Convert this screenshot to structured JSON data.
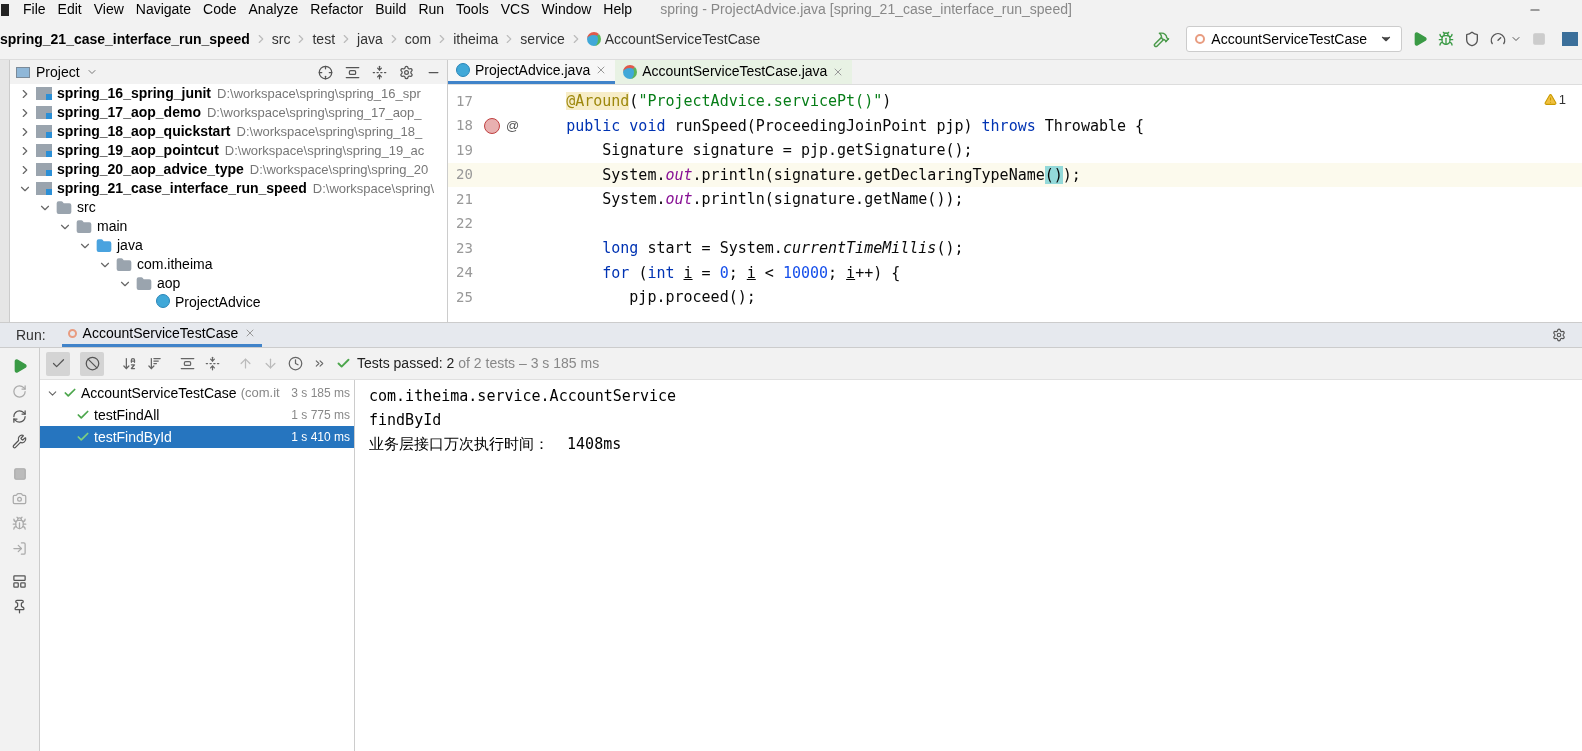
{
  "menu": [
    "File",
    "Edit",
    "View",
    "Navigate",
    "Code",
    "Analyze",
    "Refactor",
    "Build",
    "Run",
    "Tools",
    "VCS",
    "Window",
    "Help"
  ],
  "window_title": "spring - ProjectAdvice.java [spring_21_case_interface_run_speed]",
  "breadcrumbs": [
    {
      "label": "spring_21_case_interface_run_speed",
      "kind": "project"
    },
    {
      "label": "src",
      "kind": "folder"
    },
    {
      "label": "test",
      "kind": "folder"
    },
    {
      "label": "java",
      "kind": "folder"
    },
    {
      "label": "com",
      "kind": "folder"
    },
    {
      "label": "itheima",
      "kind": "folder"
    },
    {
      "label": "service",
      "kind": "folder"
    },
    {
      "label": "AccountServiceTestCase",
      "kind": "class"
    }
  ],
  "run_config": "AccountServiceTestCase",
  "project_panel": {
    "title": "Project",
    "tree": [
      {
        "name": "spring_16_spring_junit",
        "path": "D:\\workspace\\spring\\spring_16_spr",
        "kind": "module",
        "expanded": false
      },
      {
        "name": "spring_17_aop_demo",
        "path": "D:\\workspace\\spring\\spring_17_aop_",
        "kind": "module",
        "expanded": false
      },
      {
        "name": "spring_18_aop_quickstart",
        "path": "D:\\workspace\\spring\\spring_18_",
        "kind": "module",
        "expanded": false
      },
      {
        "name": "spring_19_aop_pointcut",
        "path": "D:\\workspace\\spring\\spring_19_ac",
        "kind": "module",
        "expanded": false
      },
      {
        "name": "spring_20_aop_advice_type",
        "path": "D:\\workspace\\spring\\spring_20",
        "kind": "module",
        "expanded": false
      },
      {
        "name": "spring_21_case_interface_run_speed",
        "path": "D:\\workspace\\spring\\",
        "kind": "module",
        "expanded": true,
        "children": [
          {
            "name": "src",
            "kind": "folder",
            "expanded": true,
            "children": [
              {
                "name": "main",
                "kind": "folder",
                "expanded": true,
                "children": [
                  {
                    "name": "java",
                    "kind": "source",
                    "expanded": true,
                    "children": [
                      {
                        "name": "com.itheima",
                        "kind": "package",
                        "expanded": true,
                        "children": [
                          {
                            "name": "aop",
                            "kind": "package",
                            "expanded": true,
                            "children": [
                              {
                                "name": "ProjectAdvice",
                                "kind": "class"
                              }
                            ]
                          }
                        ]
                      }
                    ]
                  }
                ]
              }
            ]
          }
        ]
      }
    ]
  },
  "editor_tabs": [
    {
      "label": "ProjectAdvice.java",
      "selected": true,
      "kind": "class"
    },
    {
      "label": "AccountServiceTestCase.java",
      "selected": false,
      "kind": "test"
    }
  ],
  "warning_count": "1",
  "code_lines": [
    {
      "number": "17",
      "current": false,
      "tokens": [
        {
          "kind": "annotation",
          "text": "    @Around"
        },
        {
          "kind": "plain",
          "text": "("
        },
        {
          "kind": "string",
          "text": "\"ProjectAdvice.servicePt()\""
        },
        {
          "kind": "plain",
          "text": ")"
        }
      ]
    },
    {
      "number": "18",
      "current": false,
      "gutter_mark": "@",
      "tokens": [
        {
          "kind": "keyword",
          "text": "    public void "
        },
        {
          "kind": "plain",
          "text": "runSpeed(ProceedingJoinPoint pjp) "
        },
        {
          "kind": "keyword",
          "text": "throws "
        },
        {
          "kind": "plain",
          "text": "Throwable {"
        }
      ]
    },
    {
      "number": "19",
      "current": false,
      "tokens": [
        {
          "kind": "plain",
          "text": "        Signature signature = pjp.getSignature();"
        }
      ]
    },
    {
      "number": "20",
      "current": true,
      "tokens": [
        {
          "kind": "plain",
          "text": "        System."
        },
        {
          "kind": "field",
          "text": "out"
        },
        {
          "kind": "plain",
          "text": ".println(signature.getDeclaringTypeName"
        },
        {
          "kind": "bracket",
          "text": "()"
        },
        {
          "kind": "plain",
          "text": ");"
        }
      ]
    },
    {
      "number": "21",
      "current": false,
      "tokens": [
        {
          "kind": "plain",
          "text": "        System."
        },
        {
          "kind": "field",
          "text": "out"
        },
        {
          "kind": "plain",
          "text": ".println(signature.getName());"
        }
      ]
    },
    {
      "number": "22",
      "current": false
    },
    {
      "number": "23",
      "current": false,
      "tokens": [
        {
          "kind": "keyword",
          "text": "        long "
        },
        {
          "kind": "plain",
          "text": "start = System."
        },
        {
          "kind": "static",
          "text": "currentTimeMillis"
        },
        {
          "kind": "plain",
          "text": "();"
        }
      ]
    },
    {
      "number": "24",
      "current": false,
      "tokens": [
        {
          "kind": "keyword",
          "text": "        for "
        },
        {
          "kind": "plain",
          "text": "("
        },
        {
          "kind": "keyword",
          "text": "int "
        },
        {
          "kind": "var",
          "text": "i"
        },
        {
          "kind": "plain",
          "text": " = "
        },
        {
          "kind": "number",
          "text": "0"
        },
        {
          "kind": "plain",
          "text": "; "
        },
        {
          "kind": "var",
          "text": "i"
        },
        {
          "kind": "plain",
          "text": " < "
        },
        {
          "kind": "number",
          "text": "10000"
        },
        {
          "kind": "plain",
          "text": "; "
        },
        {
          "kind": "var",
          "text": "i"
        },
        {
          "kind": "plain",
          "text": "++) {"
        }
      ]
    },
    {
      "number": "25",
      "current": false,
      "tokens": [
        {
          "kind": "plain",
          "text": "           pjp.proceed();"
        }
      ]
    }
  ],
  "run_panel": {
    "label": "Run:",
    "tab": "AccountServiceTestCase",
    "toggles": [
      {
        "kind": "passed",
        "on": true
      },
      {
        "kind": "ignored",
        "on": true
      }
    ],
    "status": {
      "head": "Tests passed: 2",
      "tail": "of 2 tests – 3 s 185 ms"
    },
    "tests": [
      {
        "name": "AccountServiceTestCase",
        "detail": "(com.it",
        "time": "3 s 185 ms",
        "selected": false,
        "children": [
          {
            "name": "testFindAll",
            "time": "1 s 775 ms",
            "selected": false
          },
          {
            "name": "testFindById",
            "time": "1 s 410 ms",
            "selected": true
          }
        ]
      }
    ],
    "console": [
      "com.itheima.service.AccountService",
      "findById",
      "业务层接口万次执行时间：  1408ms"
    ]
  }
}
